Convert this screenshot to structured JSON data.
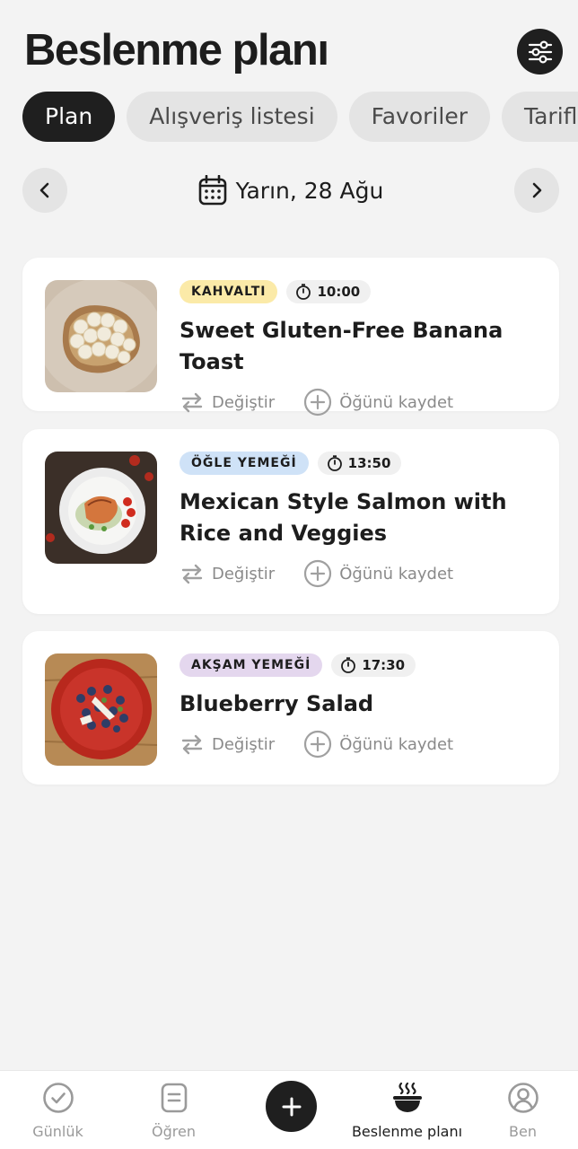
{
  "header": {
    "title": "Beslenme planı",
    "filter_icon": "sliders-icon"
  },
  "tabs": [
    {
      "label": "Plan",
      "active": true
    },
    {
      "label": "Alışveriş listesi",
      "active": false
    },
    {
      "label": "Favoriler",
      "active": false
    },
    {
      "label": "Tarifler",
      "active": false
    }
  ],
  "date_nav": {
    "label": "Yarın, 28 Ağu",
    "prev_icon": "chevron-left-icon",
    "next_icon": "chevron-right-icon",
    "calendar_icon": "calendar-icon"
  },
  "meals": [
    {
      "badge": "KAHVALTI",
      "badge_color": "#fbeaa8",
      "time": "10:00",
      "title": "Sweet Gluten-Free Banana Toast",
      "swap_label": "Değiştir",
      "log_label": "Öğünü kaydet"
    },
    {
      "badge": "ÖĞLE YEMEĞİ",
      "badge_color": "#cfe2f7",
      "time": "13:50",
      "title": "Mexican Style Salmon with Rice and Veggies",
      "swap_label": "Değiştir",
      "log_label": "Öğünü kaydet"
    },
    {
      "badge": "AKŞAM YEMEĞİ",
      "badge_color": "#e4d7ee",
      "time": "17:30",
      "title": "Blueberry Salad",
      "swap_label": "Değiştir",
      "log_label": "Öğünü kaydet"
    }
  ],
  "bottom_nav": [
    {
      "label": "Günlük",
      "icon": "check-circle-icon",
      "active": false
    },
    {
      "label": "Öğren",
      "icon": "document-icon",
      "active": false
    },
    {
      "label": "",
      "icon": "plus-icon",
      "active": false
    },
    {
      "label": "Beslenme planı",
      "icon": "meal-bowl-icon",
      "active": true
    },
    {
      "label": "Ben",
      "icon": "profile-icon",
      "active": false
    }
  ],
  "colors": {
    "accent_dark": "#1f1f1f",
    "background": "#f3f3f3",
    "muted": "#8a8a8a"
  }
}
